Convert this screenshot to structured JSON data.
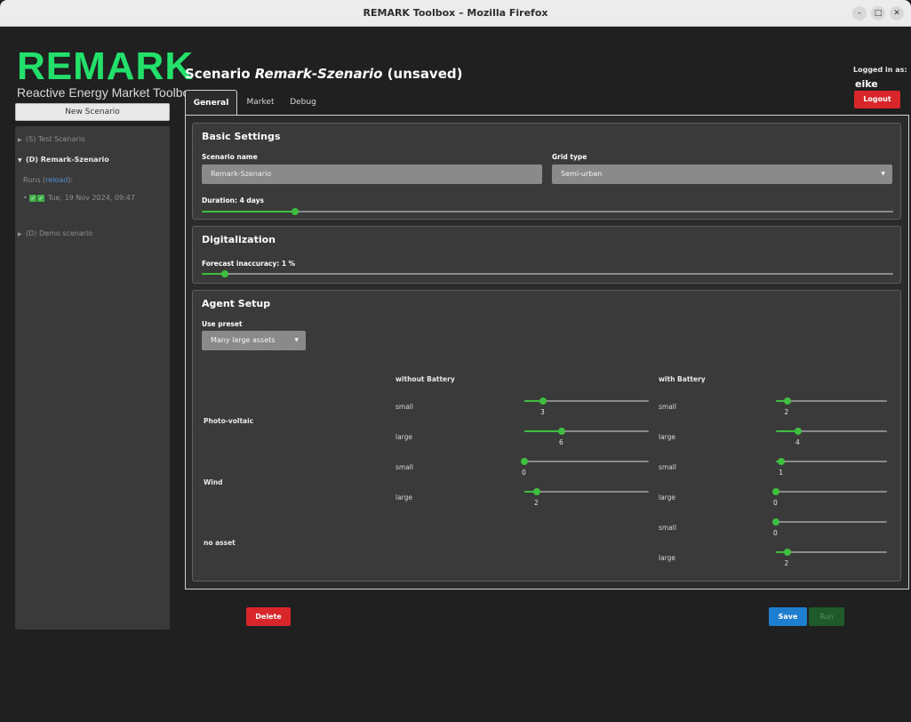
{
  "window": {
    "title": "REMARK Toolbox – Mozilla Firefox"
  },
  "sidebar": {
    "logo": "REMARK",
    "logo_subtitle": "Reactive Energy Market Toolbox",
    "new_scenario_label": "New Scenario",
    "items": [
      {
        "label": "(S) Test Scenario"
      },
      {
        "label": "(D) Remark-Szenario"
      },
      {
        "label": "(D) Demo scenario"
      }
    ],
    "runs_label": "Runs (",
    "runs_reload": "reload",
    "runs_suffix": "):",
    "run_entry": "Tue, 19 Nov 2024, 09:47",
    "run_bullet": "•"
  },
  "header": {
    "title_prefix": "Scenario",
    "scenario_name": "Remark-Szenario",
    "title_suffix": "(unsaved)",
    "logged_in_label": "Logged in as:",
    "user": "eike",
    "logout_label": "Logout"
  },
  "tabs": [
    {
      "label": "General",
      "active": true
    },
    {
      "label": "Market",
      "active": false
    },
    {
      "label": "Debug",
      "active": false
    }
  ],
  "basic_settings": {
    "heading": "Basic Settings",
    "scenario_name_label": "Scenario name",
    "scenario_name_value": "Remark-Szenario",
    "grid_type_label": "Grid type",
    "grid_type_value": "Semi-urban",
    "duration_label": "Duration: 4 days",
    "duration_fraction": 0.135
  },
  "digitalization": {
    "heading": "Digitalization",
    "forecast_label": "Forecast inaccuracy: 1 %",
    "forecast_fraction": 0.033
  },
  "agent_setup": {
    "heading": "Agent Setup",
    "preset_label": "Use preset",
    "preset_value": "Many large assets",
    "col_without": "without Battery",
    "col_with": "with Battery",
    "row_labels": {
      "pv": "Photo-voltaic",
      "wind": "Wind",
      "none": "no asset"
    },
    "size_small": "small",
    "size_large": "large",
    "values": {
      "pv_small_without": "3",
      "pv_small_with": "2",
      "pv_large_without": "6",
      "pv_large_with": "4",
      "wind_small_without": "0",
      "wind_small_with": "1",
      "wind_large_without": "2",
      "wind_large_with": "0",
      "none_small_with": "0",
      "none_large_with": "2"
    }
  },
  "actions": {
    "delete_label": "Delete",
    "save_label": "Save",
    "run_label": "Run"
  },
  "colors": {
    "accent_green": "#22e06a",
    "slider_green": "#3fbf3f",
    "danger": "#d9262b",
    "primary": "#1e7fd0"
  }
}
